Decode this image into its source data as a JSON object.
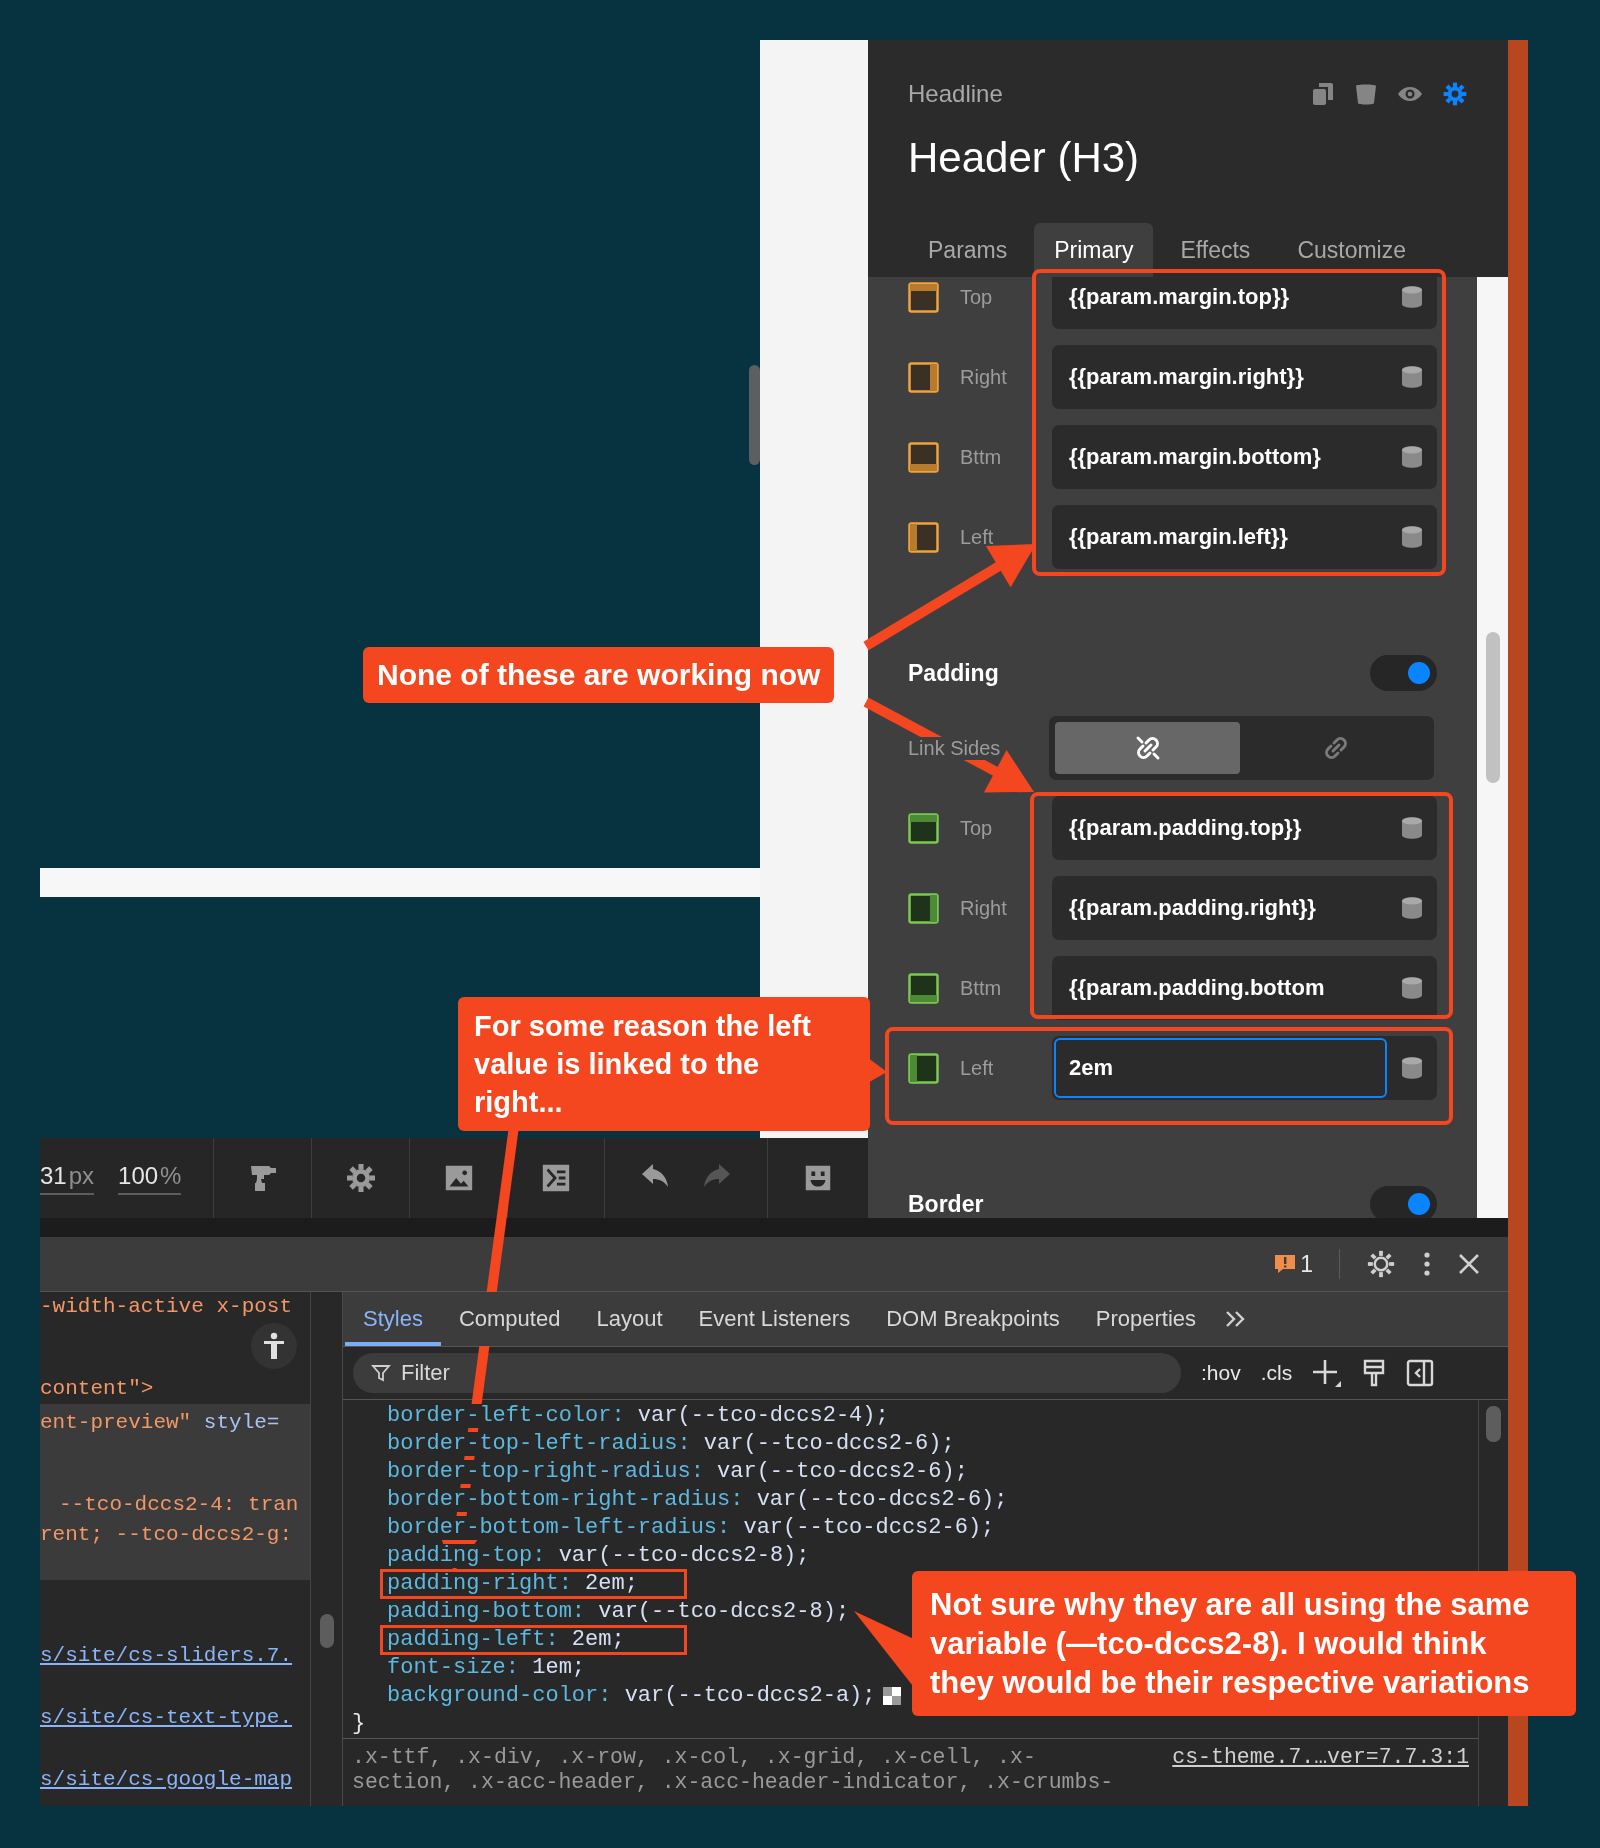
{
  "canvas": {
    "toolbar": {
      "width": {
        "value": "31",
        "unit": "px"
      },
      "zoom": {
        "value": "100",
        "unit": "%"
      },
      "tool_groups": [
        {
          "tools": [
            {
              "kind": "drill",
              "disabled": false
            }
          ]
        },
        {
          "tools": [
            {
              "kind": "gear",
              "disabled": false
            }
          ]
        },
        {
          "tools": [
            {
              "kind": "image",
              "disabled": false
            }
          ]
        },
        {
          "tools": [
            {
              "kind": "terminal",
              "disabled": false
            }
          ]
        },
        {
          "tools": [
            {
              "kind": "undo",
              "disabled": false
            },
            {
              "kind": "redo",
              "disabled": true
            }
          ]
        },
        {
          "tools": [
            {
              "kind": "sticker",
              "disabled": false
            }
          ]
        }
      ]
    }
  },
  "inspector": {
    "element_type": "Headline",
    "title": "Header (H3)",
    "tabs": [
      {
        "label": "Params",
        "selected": false
      },
      {
        "label": "Primary",
        "selected": true
      },
      {
        "label": "Effects",
        "selected": false
      },
      {
        "label": "Customize",
        "selected": false
      }
    ],
    "margin_fields": [
      {
        "kind": "top",
        "label": "Top",
        "value": "{{param.margin.top}}",
        "focused": false
      },
      {
        "kind": "right",
        "label": "Right",
        "value": "{{param.margin.right}}",
        "focused": false
      },
      {
        "kind": "bottom",
        "label": "Bttm",
        "value": "{{param.margin.bottom}",
        "focused": false
      },
      {
        "kind": "left",
        "label": "Left",
        "value": "{{param.margin.left}}",
        "focused": false
      }
    ],
    "padding": {
      "title": "Padding",
      "enabled": true,
      "link_sides": {
        "label": "Link Sides",
        "options": [
          {
            "kind": "unlink",
            "selected": true
          },
          {
            "kind": "link",
            "selected": false
          }
        ]
      },
      "fields": [
        {
          "kind": "top",
          "label": "Top",
          "value": "{{param.padding.top}}",
          "focused": false
        },
        {
          "kind": "right",
          "label": "Right",
          "value": "{{param.padding.right}}",
          "focused": false
        },
        {
          "kind": "bottom",
          "label": "Bttm",
          "value": "{{param.padding.bottom",
          "focused": false
        },
        {
          "kind": "left",
          "label": "Left",
          "value": "2em",
          "focused": true
        }
      ]
    },
    "border": {
      "title": "Border",
      "enabled": true
    }
  },
  "devtools": {
    "issue_count": "1",
    "element_lines": [
      {
        "segments": [
          {
            "kind": "value",
            "text": "-width-active x-post"
          }
        ]
      },
      {
        "segments": [
          {
            "kind": "value",
            "text": "content\">"
          }
        ]
      }
    ],
    "highlighted_lines": [
      {
        "indent": false,
        "segments": [
          {
            "kind": "value",
            "text": "ent-preview\""
          },
          {
            "kind": "attr",
            "text": " style="
          }
        ]
      },
      {
        "indent": true,
        "segments": [
          {
            "kind": "value",
            "text": "--tco-dccs2-4: tran"
          }
        ]
      },
      {
        "indent": false,
        "segments": [
          {
            "kind": "value",
            "text": "rent; --tco-dccs2-g:"
          }
        ]
      }
    ],
    "source_links": [
      "s/site/cs-sliders.7.",
      "s/site/cs-text-type.",
      "s/site/cs-google-map"
    ],
    "tabs": [
      {
        "label": "Styles",
        "selected": true
      },
      {
        "label": "Computed",
        "selected": false
      },
      {
        "label": "Layout",
        "selected": false
      },
      {
        "label": "Event Listeners",
        "selected": false
      },
      {
        "label": "DOM Breakpoints",
        "selected": false
      },
      {
        "label": "Properties",
        "selected": false
      }
    ],
    "filter_placeholder": "Filter",
    "style_toggles": [
      ":hov",
      ".cls"
    ],
    "declarations": [
      {
        "property": "border-left-color:",
        "value": "var(--tco-dccs2-4);",
        "boxed": false,
        "swatch": false
      },
      {
        "property": "border-top-left-radius:",
        "value": "var(--tco-dccs2-6);",
        "boxed": false,
        "swatch": false
      },
      {
        "property": "border-top-right-radius:",
        "value": "var(--tco-dccs2-6);",
        "boxed": false,
        "swatch": false
      },
      {
        "property": "border-bottom-right-radius:",
        "value": "var(--tco-dccs2-6);",
        "boxed": false,
        "swatch": false
      },
      {
        "property": "border-bottom-left-radius:",
        "value": "var(--tco-dccs2-6);",
        "boxed": false,
        "swatch": false
      },
      {
        "property": "padding-top:",
        "value": "var(--tco-dccs2-8);",
        "boxed": false,
        "swatch": false
      },
      {
        "property": "padding-right:",
        "value": "2em;",
        "boxed": true,
        "swatch": false
      },
      {
        "property": "padding-bottom:",
        "value": "var(--tco-dccs2-8);",
        "boxed": false,
        "swatch": false
      },
      {
        "property": "padding-left:",
        "value": "2em;",
        "boxed": true,
        "swatch": false
      },
      {
        "property": "font-size:",
        "value": "1em;",
        "boxed": false,
        "swatch": false
      },
      {
        "property": "background-color:",
        "value": "var(--tco-dccs2-a);",
        "boxed": false,
        "swatch": true
      }
    ],
    "rule_close": "}",
    "next_rule": {
      "selector_lines": [
        ".x-ttf, .x-div, .x-row, .x-col, .x-grid, .x-cell, .x-",
        "section, .x-acc-header, .x-acc-header-indicator, .x-crumbs-"
      ],
      "source": "cs-theme.7.…ver=7.7.3:1"
    }
  },
  "annotations": [
    {
      "text": "None of these are working now"
    },
    {
      "text": "For some reason the left value is linked to the right..."
    },
    {
      "text": "Not sure why they are all using the same variable (—tco-dccs2-8). I would think they would be their respective variations"
    }
  ]
}
